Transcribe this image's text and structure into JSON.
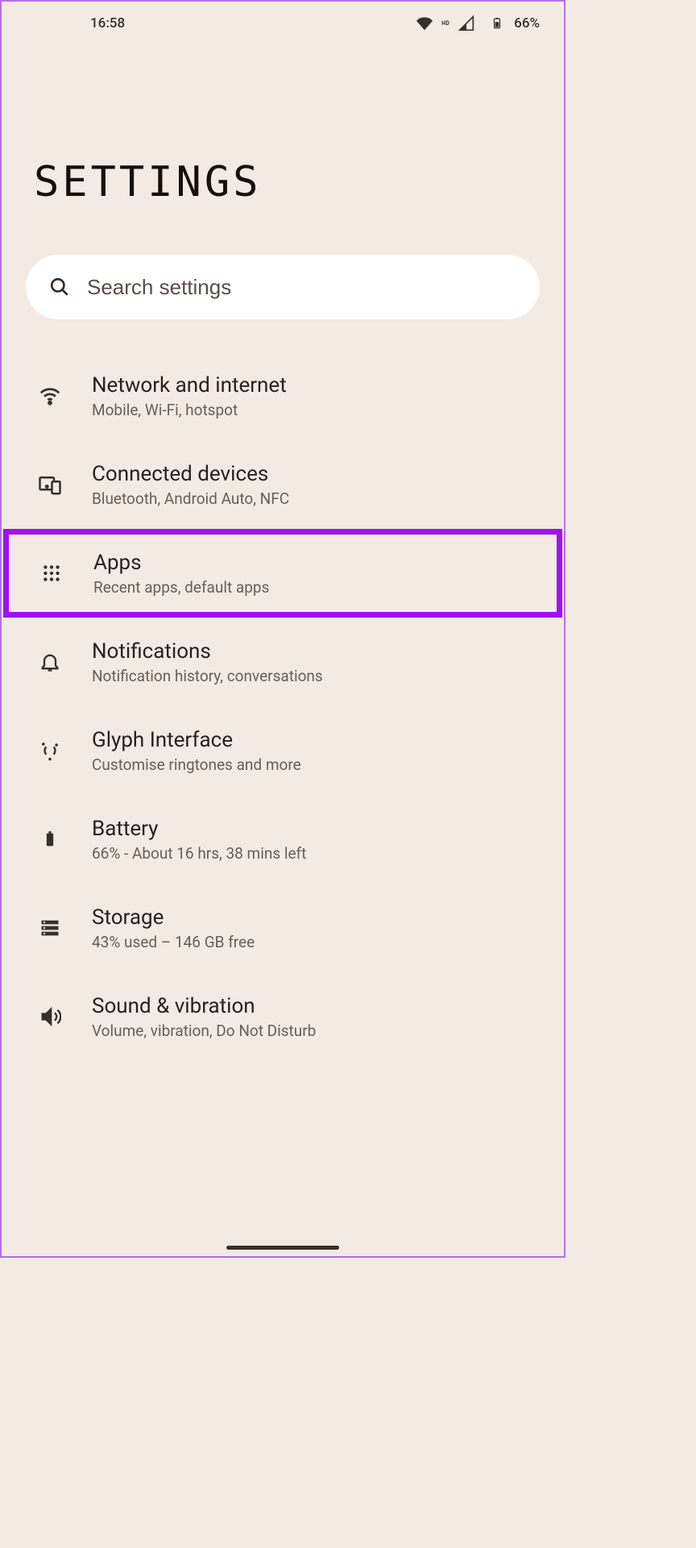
{
  "status": {
    "time": "16:58",
    "battery_pct": "66%",
    "signal_label": "HD"
  },
  "title": "SETTINGS",
  "search": {
    "placeholder": "Search settings"
  },
  "highlighted_index": 2,
  "items": [
    {
      "id": "network",
      "icon": "wifi-icon",
      "title": "Network and internet",
      "sub": "Mobile, Wi-Fi, hotspot"
    },
    {
      "id": "connected",
      "icon": "devices-icon",
      "title": "Connected devices",
      "sub": "Bluetooth, Android Auto, NFC"
    },
    {
      "id": "apps",
      "icon": "apps-icon",
      "title": "Apps",
      "sub": "Recent apps, default apps"
    },
    {
      "id": "notifications",
      "icon": "bell-icon",
      "title": "Notifications",
      "sub": "Notification history, conversations"
    },
    {
      "id": "glyph",
      "icon": "glyph-icon",
      "title": "Glyph Interface",
      "sub": "Customise ringtones and more"
    },
    {
      "id": "battery",
      "icon": "battery-icon",
      "title": "Battery",
      "sub": "66% - About 16 hrs, 38 mins left"
    },
    {
      "id": "storage",
      "icon": "storage-icon",
      "title": "Storage",
      "sub": "43% used – 146 GB free"
    },
    {
      "id": "sound",
      "icon": "sound-icon",
      "title": "Sound & vibration",
      "sub": "Volume, vibration, Do Not Disturb"
    }
  ]
}
